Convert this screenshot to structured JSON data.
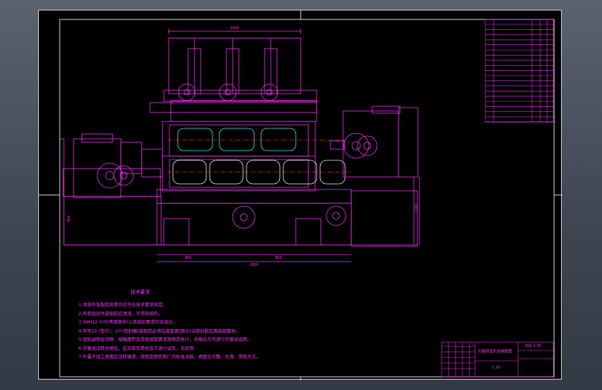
{
  "title_block": {
    "drawing_no": "ZHJ-3.00",
    "name": "五辊矫直机总装配图",
    "scale": "1:10"
  },
  "tech_notes": {
    "title": "技术要求",
    "lines": [
      "1.本部件装配前各零件应符合技术要求规定。",
      "2.所有密封件装配前应清洗，不得有损伤。",
      "3.SNH12.3.00等零部件(1)各密封要求符合设计。",
      "4.序号22 (垫片)、23 (密封圈)装配前必须在装配面(图示)涂密封胶后再装配整体。",
      "5.齿轮副啮合间隙、接触面积及其他装配要求按规定执行，合格后方可进行空载试运转。",
      "6.空载试运转合格后，在实际负荷状态下进行试车，无异常。",
      "7.外露不加工表面应涂防锈漆，按规定颜色和厂内标准涂装，表面应平整、光滑、美观大方。"
    ]
  },
  "dimensions": {
    "top_width": "2000",
    "bottom_width": "2800",
    "bottom_left": "400",
    "bottom_right": "800",
    "left_height": "900",
    "right_height": "1200"
  }
}
